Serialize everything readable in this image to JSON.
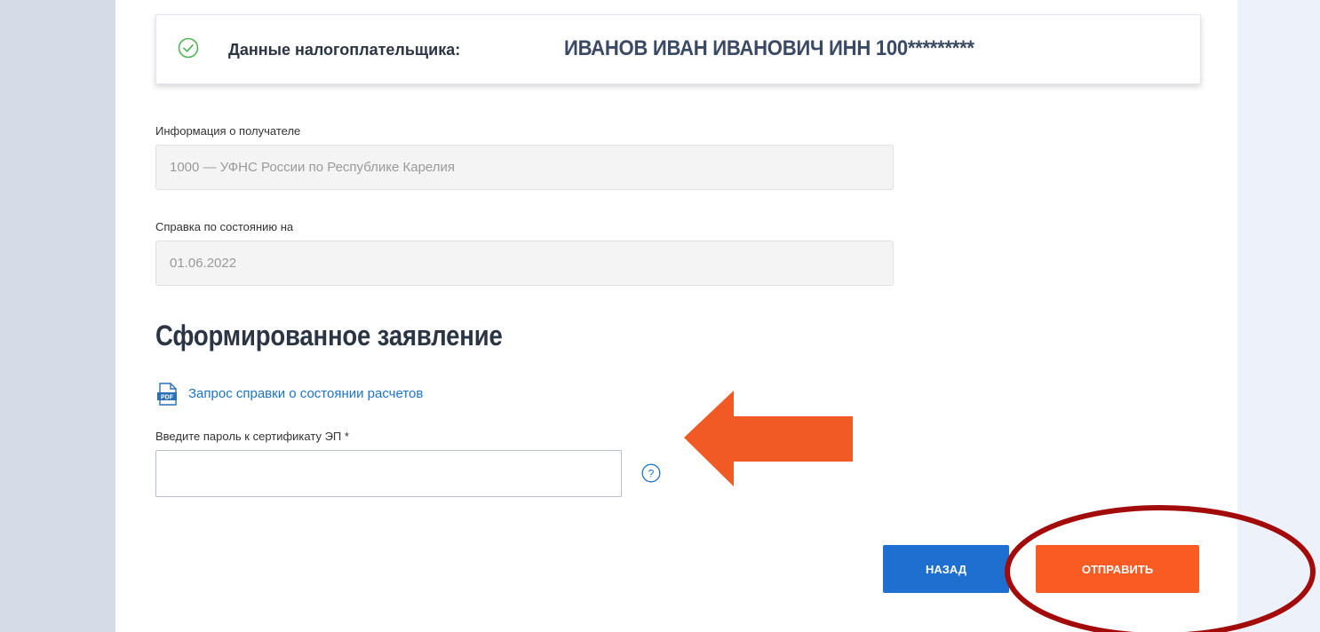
{
  "taxpayer": {
    "label": "Данные налогоплательщика:",
    "value": "ИВАНОВ ИВАН ИВАНОВИЧ ИНН 100*********"
  },
  "recipient": {
    "label": "Информация о получателе",
    "value": "1000 — УФНС России по Республике Карелия"
  },
  "report_date": {
    "label": "Справка по состоянию на",
    "value": "01.06.2022"
  },
  "section": {
    "title": "Сформированное заявление",
    "pdf_link": "Запрос справки о состоянии расчетов"
  },
  "password": {
    "label": "Введите пароль к сертификату ЭП *",
    "value": ""
  },
  "buttons": {
    "back": "НАЗАД",
    "send": "ОТПРАВИТЬ"
  },
  "icons": {
    "check": "check-circle-icon",
    "pdf": "pdf-icon",
    "help": "question-circle-icon"
  },
  "colors": {
    "accent_blue": "#1f6fd1",
    "accent_orange": "#fa5b23",
    "annotation_arrow": "#f15a24",
    "annotation_ellipse": "#a30b0b",
    "success_green": "#4caf50"
  }
}
